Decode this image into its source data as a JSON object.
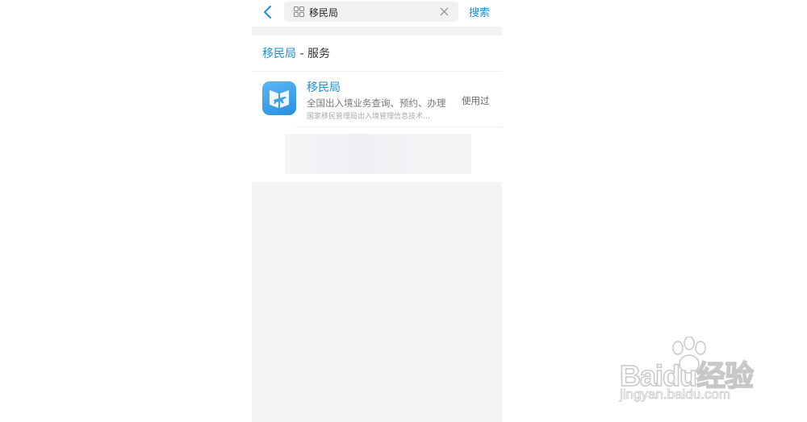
{
  "topbar": {
    "search_value": "移民局",
    "search_button": "搜索"
  },
  "section": {
    "keyword": "移民局",
    "suffix": " - 服务"
  },
  "result": {
    "name": "移民局",
    "description": "全国出入境业务查询、预约、办理",
    "provider": "国家移民管理局出入境管理信息技术…",
    "tag": "使用过"
  },
  "watermark": {
    "brand": "Baidu经验",
    "url": "jingyan.baidu.com"
  },
  "colors": {
    "accent": "#1a8fd6",
    "page_bg": "#f2f3f5",
    "app_icon": "#3a9ee8"
  },
  "icons": {
    "back": "chevron-left-icon",
    "grid": "mini-program-grid-icon",
    "clear": "close-icon",
    "app": "immigration-app-icon"
  }
}
